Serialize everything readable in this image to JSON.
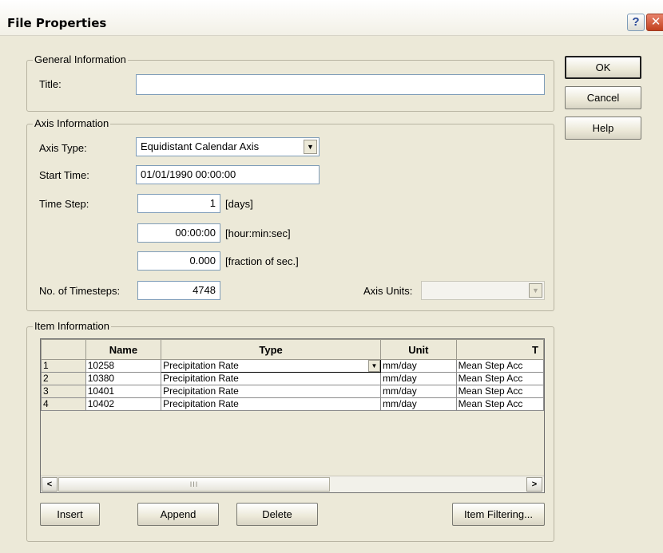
{
  "window": {
    "title": "File Properties",
    "help_glyph": "?",
    "close_glyph": "✕"
  },
  "general": {
    "legend": "General Information",
    "title_label": "Title:",
    "title_value": ""
  },
  "axis": {
    "legend": "Axis Information",
    "type_label": "Axis Type:",
    "type_value": "Equidistant Calendar Axis",
    "start_label": "Start Time:",
    "start_value": "01/01/1990 00:00:00",
    "step_label": "Time Step:",
    "step_days": "1",
    "step_days_unit": "[days]",
    "step_hms": "00:00:00",
    "step_hms_unit": "[hour:min:sec]",
    "step_frac": "0.000",
    "step_frac_unit": "[fraction of sec.]",
    "count_label": "No. of Timesteps:",
    "count_value": "4748",
    "units_label": "Axis Units:",
    "units_value": ""
  },
  "items": {
    "legend": "Item Information",
    "columns": [
      "",
      "Name",
      "Type",
      "Unit",
      "T"
    ],
    "rows": [
      {
        "num": "1",
        "name": "10258",
        "type": "Precipitation Rate",
        "unit": "mm/day",
        "tvalue": "Mean Step Acc"
      },
      {
        "num": "2",
        "name": "10380",
        "type": "Precipitation Rate",
        "unit": "mm/day",
        "tvalue": "Mean Step Acc"
      },
      {
        "num": "3",
        "name": "10401",
        "type": "Precipitation Rate",
        "unit": "mm/day",
        "tvalue": "Mean Step Acc"
      },
      {
        "num": "4",
        "name": "10402",
        "type": "Precipitation Rate",
        "unit": "mm/day",
        "tvalue": "Mean Step Acc"
      }
    ],
    "scroll_left": "<",
    "scroll_right": ">",
    "scroll_grip": "III",
    "insert_label": "Insert",
    "append_label": "Append",
    "delete_label": "Delete",
    "filter_label": "Item Filtering..."
  },
  "buttons": {
    "ok": "OK",
    "cancel": "Cancel",
    "help": "Help"
  },
  "icons": {
    "dropdown": "chevron-down-icon",
    "help": "help-icon",
    "close": "close-icon"
  }
}
